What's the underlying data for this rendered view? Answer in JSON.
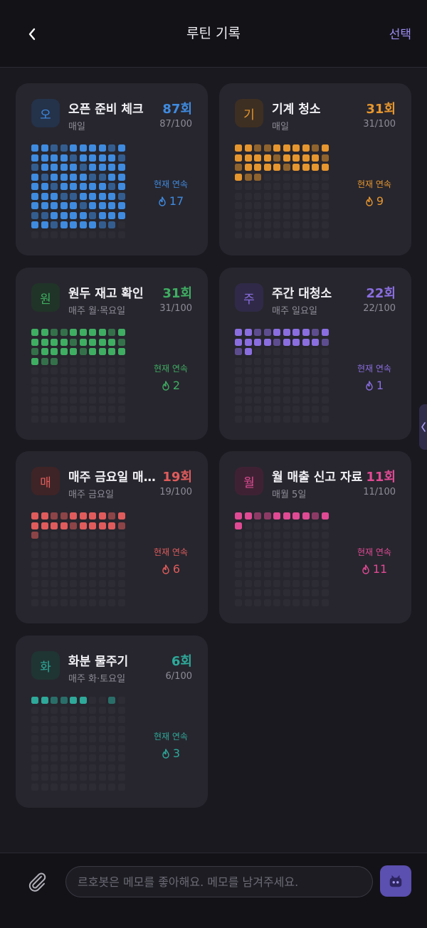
{
  "header": {
    "title": "루틴 기록",
    "select_label": "선택"
  },
  "streak_label": "현재 연속",
  "cards": [
    {
      "badge": "오",
      "title": "오픈 준비 체크",
      "count": "87회",
      "freq": "매일",
      "progress": "87/100",
      "streak": "17",
      "accent": "#3f8be0",
      "badge_bg": "#24324a",
      "done": 87
    },
    {
      "badge": "기",
      "title": "기계 청소",
      "count": "31회",
      "freq": "매일",
      "progress": "31/100",
      "streak": "9",
      "accent": "#e6962e",
      "badge_bg": "#3d2f22",
      "done": 31
    },
    {
      "badge": "원",
      "title": "원두 재고 확인",
      "count": "31회",
      "freq": "매주 월·목요일",
      "progress": "31/100",
      "streak": "2",
      "accent": "#3fae62",
      "badge_bg": "#203427",
      "done": 31
    },
    {
      "badge": "주",
      "title": "주간 대청소",
      "count": "22회",
      "freq": "매주 일요일",
      "progress": "22/100",
      "streak": "1",
      "accent": "#8a6ee0",
      "badge_bg": "#302a48",
      "done": 22
    },
    {
      "badge": "매",
      "title": "매주 금요일 매출 정리",
      "count": "19회",
      "freq": "매주 금요일",
      "progress": "19/100",
      "streak": "6",
      "accent": "#e05c5c",
      "badge_bg": "#3e2426",
      "done": 19
    },
    {
      "badge": "월",
      "title": "월 매출 신고 자료",
      "count": "11회",
      "freq": "매월 5일",
      "progress": "11/100",
      "streak": "11",
      "accent": "#e04a94",
      "badge_bg": "#3e2233",
      "done": 11
    },
    {
      "badge": "화",
      "title": "화분 물주기",
      "count": "6회",
      "freq": "매주 화·토요일",
      "progress": "6/100",
      "streak": "3",
      "accent": "#2ea99a",
      "badge_bg": "#1f3533",
      "done": 6
    }
  ],
  "memo": {
    "placeholder": "르호봇은 메모를 좋아해요. 메모를 남겨주세요."
  }
}
